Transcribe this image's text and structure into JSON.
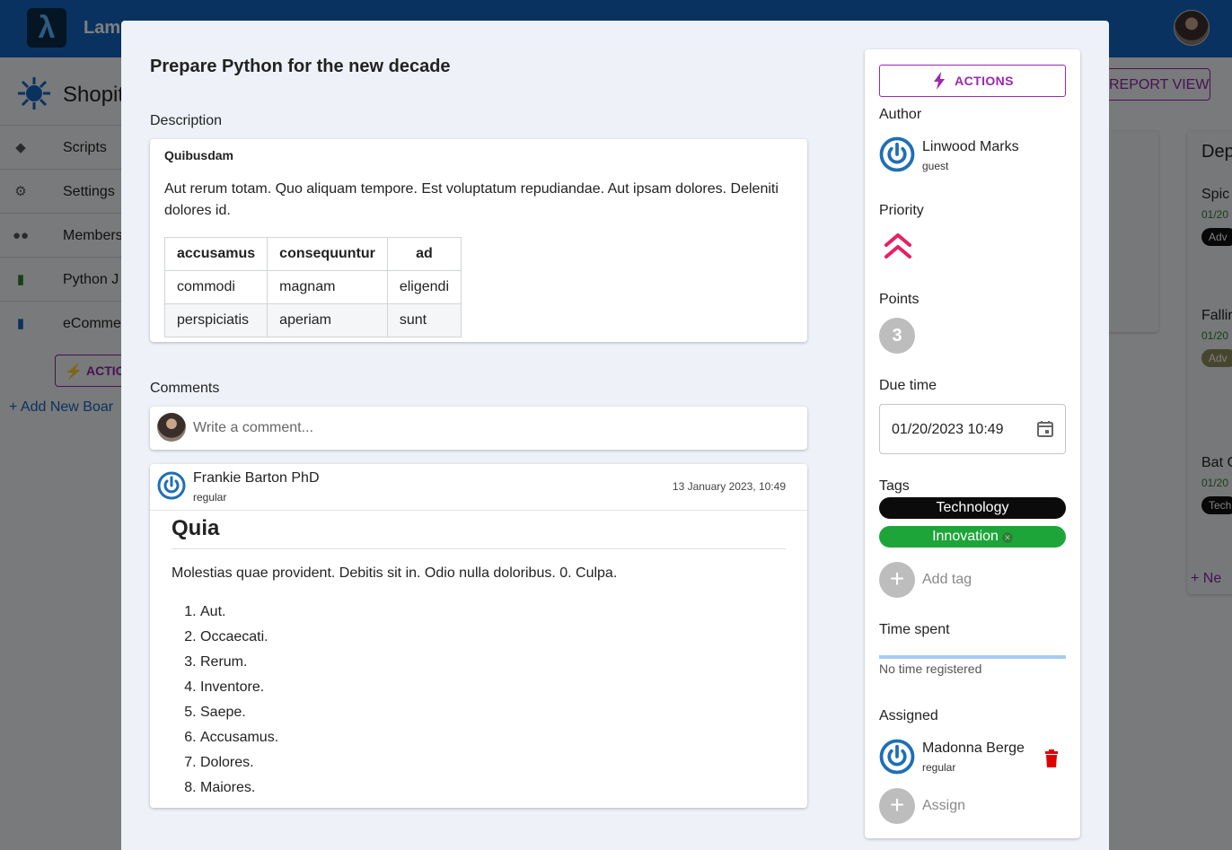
{
  "app": {
    "name": "Lam"
  },
  "company": {
    "name": "Shopit"
  },
  "sidebar": {
    "items": [
      {
        "label": "Scripts"
      },
      {
        "label": "Settings"
      },
      {
        "label": "Members"
      },
      {
        "label": "Python J"
      },
      {
        "label": "eComme"
      }
    ],
    "actions_label": "ACTIO",
    "add_board_label": "+ Add New Boar"
  },
  "board": {
    "report_view_label": "REPORT VIEW",
    "column_partial_title": "Dep",
    "cards": [
      {
        "title": "Spic",
        "date": "01/20",
        "chip": "Adv"
      },
      {
        "title": "Fallir",
        "date": "01/20",
        "chip": "Adv"
      },
      {
        "title": "Bat C",
        "date": "01/20",
        "chip": "Tech"
      }
    ],
    "new_label": "+ Ne"
  },
  "task": {
    "title": "Prepare Python for the new decade",
    "description_label": "Description",
    "description": {
      "heading": "Quibusdam",
      "paragraph": "Aut rerum totam. Quo aliquam tempore. Est voluptatum repudiandae. Aut ipsam dolores. Deleniti dolores id.",
      "table": {
        "headers": [
          "accusamus",
          "consequuntur",
          "ad"
        ],
        "rows": [
          [
            "commodi",
            "magnam",
            "eligendi"
          ],
          [
            "perspiciatis",
            "aperiam",
            "sunt"
          ]
        ]
      }
    },
    "comments_label": "Comments",
    "comment_placeholder": "Write a comment...",
    "comments": [
      {
        "author": "Frankie Barton PhD",
        "role": "regular",
        "date": "13 January 2023, 10:49",
        "heading": "Quia",
        "paragraph": "Molestias quae provident. Debitis sit in. Odio nulla doloribus. 0. Culpa.",
        "list": [
          "Aut.",
          "Occaecati.",
          "Rerum.",
          "Inventore.",
          "Saepe.",
          "Accusamus.",
          "Dolores.",
          "Maiores."
        ]
      }
    ]
  },
  "panel": {
    "actions_label": "ACTIONS",
    "author_label": "Author",
    "author": {
      "name": "Linwood Marks",
      "role": "guest"
    },
    "priority_label": "Priority",
    "priority_icon": "double-chevron-up-icon",
    "points_label": "Points",
    "points": "3",
    "due_label": "Due time",
    "due_value": "01/20/2023 10:49",
    "tags_label": "Tags",
    "tags": [
      {
        "label": "Technology",
        "color": "#0b0b0b"
      },
      {
        "label": "Innovation",
        "color": "#1ea53a"
      }
    ],
    "add_tag_label": "Add tag",
    "time_spent_label": "Time spent",
    "time_spent_fraction": 0,
    "no_time_label": "No time registered",
    "assigned_label": "Assigned",
    "assignee": {
      "name": "Madonna Berge",
      "role": "regular"
    },
    "assign_label": "Assign"
  },
  "colors": {
    "primary": "#1565c0",
    "accent": "#9c27b0",
    "priority": "#e91e63",
    "delete": "#e00000"
  }
}
